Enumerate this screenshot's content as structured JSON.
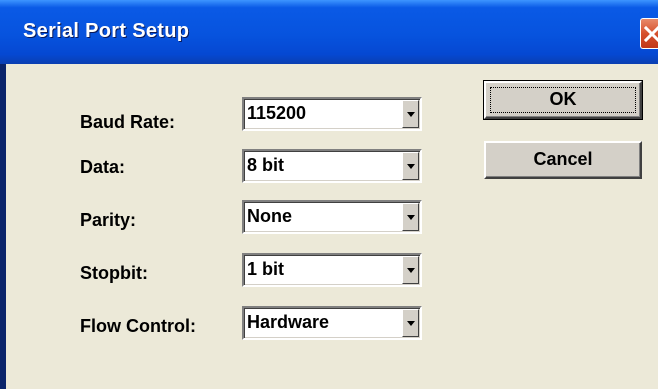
{
  "window": {
    "title": "Serial Port Setup"
  },
  "fields": {
    "baud_rate": {
      "label": "Baud Rate:",
      "value": "115200"
    },
    "data": {
      "label": "Data:",
      "value": "8 bit"
    },
    "parity": {
      "label": "Parity:",
      "value": "None"
    },
    "stopbit": {
      "label": "Stopbit:",
      "value": "1 bit"
    },
    "flow_control": {
      "label": "Flow Control:",
      "value": "Hardware"
    }
  },
  "buttons": {
    "ok": "OK",
    "cancel": "Cancel"
  },
  "icons": {
    "close": "close-icon",
    "dropdown": "chevron-down-icon"
  },
  "colors": {
    "titlebar": "#0753de",
    "close_button": "#d6502c",
    "dialog_face": "#ece9d8"
  }
}
